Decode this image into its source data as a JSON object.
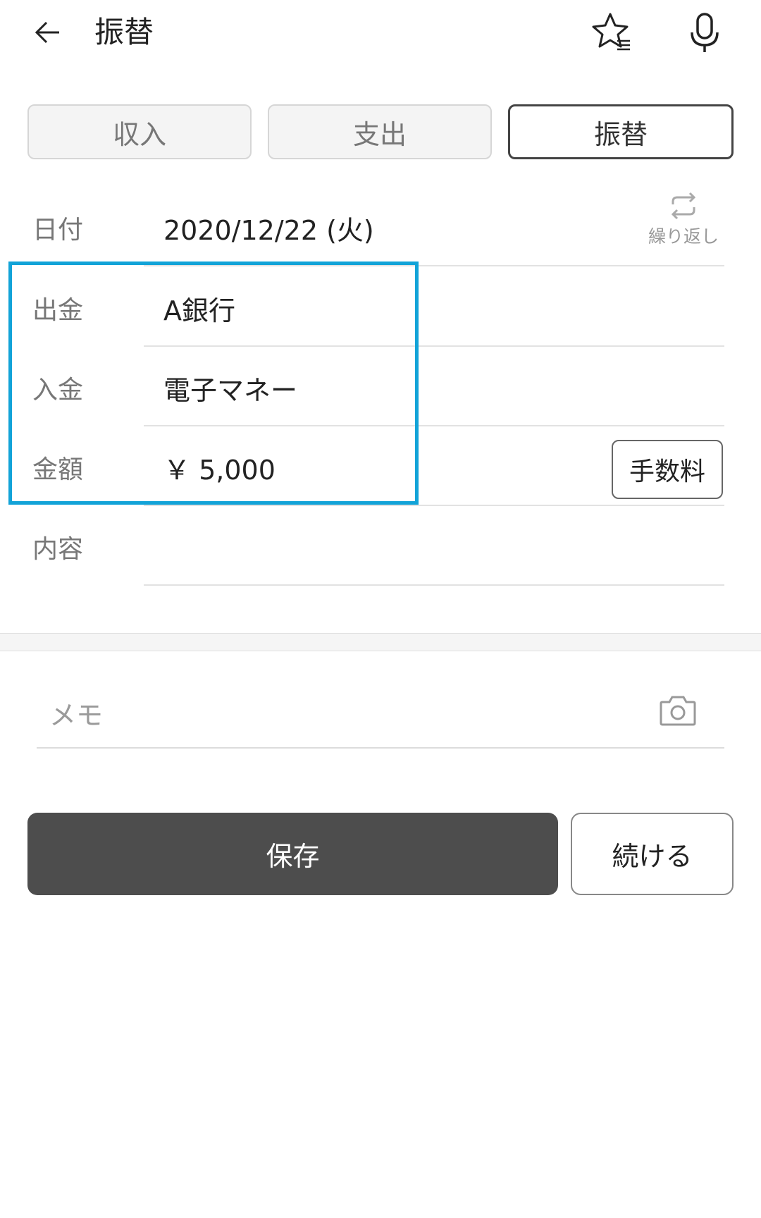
{
  "header": {
    "title": "振替",
    "icons": {
      "back": "arrow-left-icon",
      "favorite": "star-list-icon",
      "voice": "microphone-icon"
    }
  },
  "tabs": [
    {
      "label": "収入",
      "active": false
    },
    {
      "label": "支出",
      "active": false
    },
    {
      "label": "振替",
      "active": true
    }
  ],
  "form": {
    "date": {
      "label": "日付",
      "value": "2020/12/22 (火)"
    },
    "repeat": {
      "label": "繰り返し",
      "icon": "repeat-icon"
    },
    "withdrawal": {
      "label": "出金",
      "value": "A銀行"
    },
    "deposit": {
      "label": "入金",
      "value": "電子マネー"
    },
    "amount": {
      "label": "金額",
      "value": "￥ 5,000"
    },
    "fee_button": "手数料",
    "content": {
      "label": "内容",
      "value": ""
    }
  },
  "memo": {
    "placeholder": "メモ",
    "value": "",
    "icon": "camera-icon"
  },
  "actions": {
    "save": "保存",
    "continue": "続ける"
  },
  "colors": {
    "highlight": "#12a3d8",
    "save_bg": "#4d4d4d"
  }
}
